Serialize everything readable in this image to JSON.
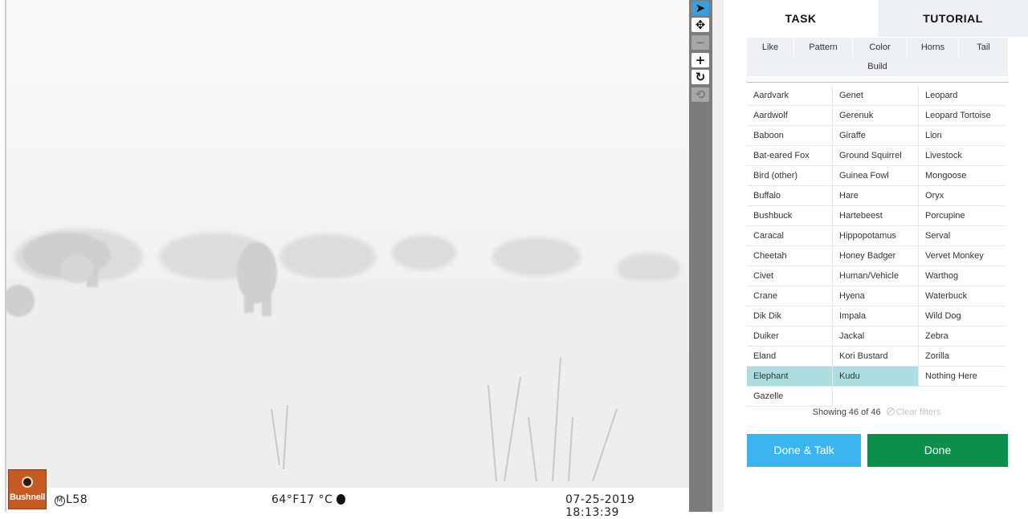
{
  "tabs": {
    "task": "TASK",
    "tutorial": "TUTORIAL"
  },
  "filters": {
    "row1": [
      "Like",
      "Pattern",
      "Color",
      "Horns",
      "Tail"
    ],
    "row2": [
      "Build"
    ]
  },
  "species": [
    [
      "Aardvark",
      "Genet",
      "Leopard"
    ],
    [
      "Aardwolf",
      "Gerenuk",
      "Leopard Tortoise"
    ],
    [
      "Baboon",
      "Giraffe",
      "Lion"
    ],
    [
      "Bat-eared Fox",
      "Ground Squirrel",
      "Livestock"
    ],
    [
      "Bird (other)",
      "Guinea Fowl",
      "Mongoose"
    ],
    [
      "Buffalo",
      "Hare",
      "Oryx"
    ],
    [
      "Bushbuck",
      "Hartebeest",
      "Porcupine"
    ],
    [
      "Caracal",
      "Hippopotamus",
      "Serval"
    ],
    [
      "Cheetah",
      "Honey Badger",
      "Vervet Monkey"
    ],
    [
      "Civet",
      "Human/Vehicle",
      "Warthog"
    ],
    [
      "Crane",
      "Hyena",
      "Waterbuck"
    ],
    [
      "Dik Dik",
      "Impala",
      "Wild Dog"
    ],
    [
      "Duiker",
      "Jackal",
      "Zebra"
    ],
    [
      "Eland",
      "Kori Bustard",
      "Zorilla"
    ],
    [
      "Elephant",
      "Kudu",
      "Nothing Here"
    ],
    [
      "Gazelle",
      "",
      ""
    ]
  ],
  "selected": [
    "Elephant",
    "Kudu"
  ],
  "status": {
    "showing": "Showing 46 of 46",
    "clear": "Clear filters"
  },
  "buttons": {
    "done_talk": "Done & Talk",
    "done": "Done"
  },
  "camera": {
    "brand": "Bushnell",
    "camera_id": "L58",
    "temperature": "64°F17 °C",
    "date": "07-25-2019",
    "time": "18:13:39"
  },
  "toolbar": [
    "pointer-icon",
    "move-icon",
    "zoom-out-icon",
    "zoom-in-icon",
    "rotate-icon",
    "reset-icon"
  ],
  "colors": {
    "selected": "#aedde0",
    "done_talk": "#3bb5ef",
    "done": "#0b8f4a",
    "filter_bg": "#edf1f3"
  }
}
